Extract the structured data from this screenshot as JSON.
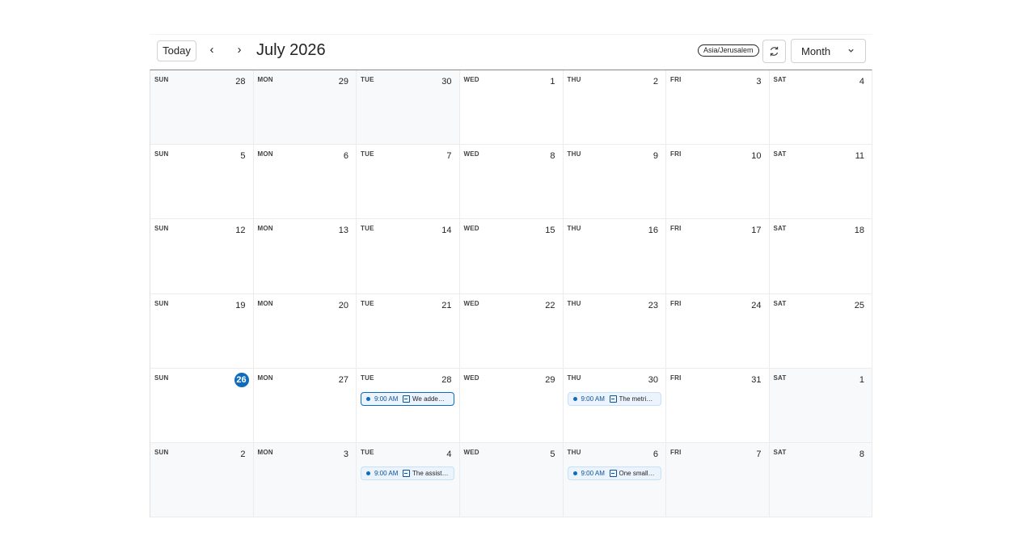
{
  "toolbar": {
    "today_label": "Today",
    "prev_icon": "chevron-left-icon",
    "next_icon": "chevron-right-icon",
    "title": "July 2026",
    "timezone": "Asia/Jerusalem",
    "refresh_icon": "refresh-icon",
    "view_value": "Month",
    "view_icon": "chevron-down-icon"
  },
  "weekday_labels": [
    "SUN",
    "MON",
    "TUE",
    "WED",
    "THU",
    "FRI",
    "SAT"
  ],
  "weeks": [
    [
      {
        "day": "28",
        "out": true
      },
      {
        "day": "29",
        "out": true
      },
      {
        "day": "30",
        "out": true
      },
      {
        "day": "1"
      },
      {
        "day": "2"
      },
      {
        "day": "3"
      },
      {
        "day": "4"
      }
    ],
    [
      {
        "day": "5"
      },
      {
        "day": "6"
      },
      {
        "day": "7"
      },
      {
        "day": "8"
      },
      {
        "day": "9"
      },
      {
        "day": "10"
      },
      {
        "day": "11"
      }
    ],
    [
      {
        "day": "12"
      },
      {
        "day": "13"
      },
      {
        "day": "14"
      },
      {
        "day": "15"
      },
      {
        "day": "16"
      },
      {
        "day": "17"
      },
      {
        "day": "18"
      }
    ],
    [
      {
        "day": "19"
      },
      {
        "day": "20"
      },
      {
        "day": "21"
      },
      {
        "day": "22"
      },
      {
        "day": "23"
      },
      {
        "day": "24"
      },
      {
        "day": "25"
      }
    ],
    [
      {
        "day": "26",
        "today": true
      },
      {
        "day": "27"
      },
      {
        "day": "28",
        "events": [
          {
            "time": "9:00 AM",
            "title": "We adde…",
            "selected": true
          }
        ]
      },
      {
        "day": "29"
      },
      {
        "day": "30",
        "events": [
          {
            "time": "9:00 AM",
            "title": "The metri…"
          }
        ]
      },
      {
        "day": "31"
      },
      {
        "day": "1",
        "out": true
      }
    ],
    [
      {
        "day": "2",
        "out": true
      },
      {
        "day": "3",
        "out": true
      },
      {
        "day": "4",
        "out": true,
        "events": [
          {
            "time": "9:00 AM",
            "title": "The assist…"
          }
        ]
      },
      {
        "day": "5",
        "out": true
      },
      {
        "day": "6",
        "out": true,
        "events": [
          {
            "time": "9:00 AM",
            "title": "One small…"
          }
        ]
      },
      {
        "day": "7",
        "out": true
      },
      {
        "day": "8",
        "out": true
      }
    ]
  ],
  "colors": {
    "accent": "#0f6cbd",
    "event_bg": "#ebf3fc",
    "out_of_month_bg": "#f7f9fb"
  }
}
